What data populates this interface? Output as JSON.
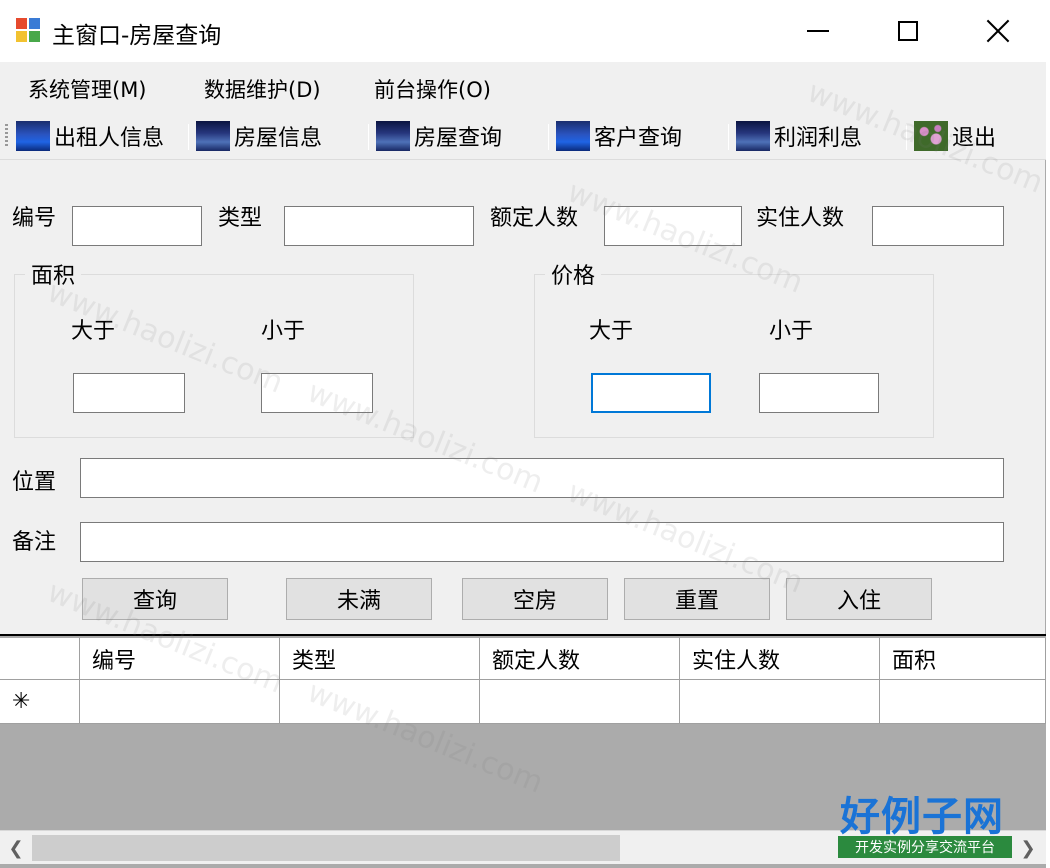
{
  "window": {
    "title": "主窗口-房屋查询"
  },
  "menu": {
    "items": [
      "系统管理(M)",
      "数据维护(D)",
      "前台操作(O)"
    ]
  },
  "toolbar": {
    "buttons": [
      {
        "label": "出租人信息",
        "icon": "blue-ocean-icon"
      },
      {
        "label": "房屋信息",
        "icon": "dark-ocean-icon"
      },
      {
        "label": "房屋查询",
        "icon": "dark-ocean-icon"
      },
      {
        "label": "客户查询",
        "icon": "blue-ocean-icon"
      },
      {
        "label": "利润利息",
        "icon": "dark-ocean-icon"
      },
      {
        "label": "退出",
        "icon": "flower-icon"
      }
    ]
  },
  "form": {
    "id_label": "编号",
    "type_label": "类型",
    "rated_people_label": "额定人数",
    "actual_people_label": "实住人数",
    "area_group": {
      "title": "面积",
      "greater_label": "大于",
      "less_label": "小于"
    },
    "price_group": {
      "title": "价格",
      "greater_label": "大于",
      "less_label": "小于"
    },
    "location_label": "位置",
    "remark_label": "备注",
    "fields": {
      "id": "",
      "type": "",
      "rated_people": "",
      "actual_people": "",
      "area_min": "",
      "area_max": "",
      "price_min": "",
      "price_max": "",
      "location": "",
      "remark": ""
    }
  },
  "buttons": {
    "query": "查询",
    "not_full": "未满",
    "empty": "空房",
    "reset": "重置",
    "checkin": "入住"
  },
  "grid": {
    "columns": [
      "编号",
      "类型",
      "额定人数",
      "实住人数",
      "面积"
    ],
    "new_row_marker": "✳"
  },
  "watermark": {
    "text": "www.haolizi.com",
    "logo": "好例子网",
    "logo_sub": "开发实例分享交流平台"
  },
  "colors": {
    "focus_border": "#0078d7",
    "grid_bg": "#ababab",
    "logo_blue": "#1a73d6",
    "logo_green": "#2b8a3e"
  }
}
